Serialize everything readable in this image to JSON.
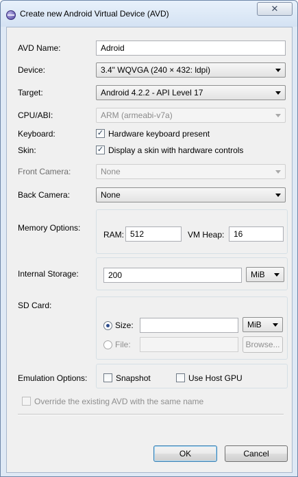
{
  "window": {
    "title": "Create new Android Virtual Device (AVD)",
    "close_glyph": "✕"
  },
  "form": {
    "avd_name": {
      "label": "AVD Name:",
      "value": "Adroid"
    },
    "device": {
      "label": "Device:",
      "value": "3.4\" WQVGA (240 × 432: ldpi)"
    },
    "target": {
      "label": "Target:",
      "value": "Android 4.2.2 - API Level 17"
    },
    "cpu_abi": {
      "label": "CPU/ABI:",
      "value": "ARM (armeabi-v7a)"
    },
    "keyboard": {
      "label": "Keyboard:",
      "checkbox_label": "Hardware keyboard present",
      "checked": true
    },
    "skin": {
      "label": "Skin:",
      "checkbox_label": "Display a skin with hardware controls",
      "checked": true
    },
    "front_camera": {
      "label": "Front Camera:",
      "value": "None"
    },
    "back_camera": {
      "label": "Back Camera:",
      "value": "None"
    },
    "memory": {
      "label": "Memory Options:",
      "ram_label": "RAM:",
      "ram_value": "512",
      "vm_heap_label": "VM Heap:",
      "vm_heap_value": "16"
    },
    "internal_storage": {
      "label": "Internal Storage:",
      "value": "200",
      "unit": "MiB"
    },
    "sd_card": {
      "label": "SD Card:",
      "size_label": "Size:",
      "size_value": "",
      "size_unit": "MiB",
      "size_selected": true,
      "file_label": "File:",
      "file_value": "",
      "browse_label": "Browse..."
    },
    "emulation": {
      "label": "Emulation Options:",
      "snapshot_label": "Snapshot",
      "snapshot_checked": false,
      "host_gpu_label": "Use Host GPU",
      "host_gpu_checked": false
    },
    "override": {
      "label": "Override the existing AVD with the same name",
      "checked": false
    }
  },
  "buttons": {
    "ok": "OK",
    "cancel": "Cancel"
  },
  "colors": {
    "title_bar": "#dce8f5",
    "dialog_bg": "#f0f0f0",
    "default_button_border": "#3c7fb1"
  }
}
